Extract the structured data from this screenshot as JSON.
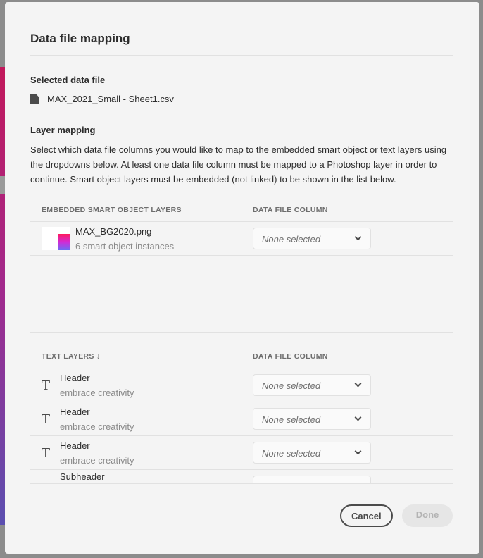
{
  "dialog": {
    "title": "Data file mapping",
    "cancel": "Cancel",
    "done": "Done"
  },
  "selected": {
    "heading": "Selected data file",
    "file": "MAX_2021_Small - Sheet1.csv"
  },
  "mapping": {
    "heading": "Layer mapping",
    "description": "Select which data file columns you would like to map to the embedded smart object or text layers using the dropdowns below. At least one data file column must be mapped to a Photoshop layer in order to continue. Smart object layers must be embedded (not linked) to be shown in the list below."
  },
  "smart": {
    "col1": "EMBEDDED SMART OBJECT LAYERS",
    "col2": "DATA FILE COLUMN",
    "rows": [
      {
        "name": "MAX_BG2020.png",
        "sub": "6 smart object instances",
        "value": "None selected"
      }
    ]
  },
  "text": {
    "col1": "TEXT LAYERS ↓",
    "col2": "DATA FILE COLUMN",
    "rows": [
      {
        "name": "Header",
        "sub": "embrace creativity",
        "value": "None selected"
      },
      {
        "name": "Header",
        "sub": "embrace creativity",
        "value": "None selected"
      },
      {
        "name": "Header",
        "sub": "embrace creativity",
        "value": "None selected"
      },
      {
        "name": "Subheader",
        "sub": "",
        "value": ""
      }
    ]
  }
}
